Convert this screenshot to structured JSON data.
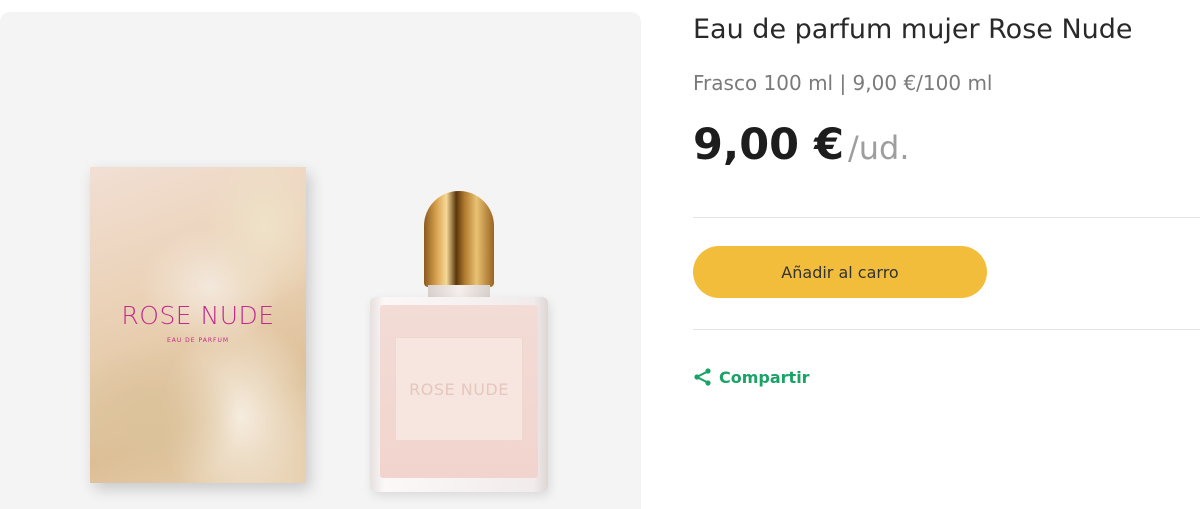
{
  "product": {
    "title": "Eau de parfum mujer Rose Nude",
    "format": "Frasco 100 ml | 9,00 €/100 ml",
    "price": "9,00 €",
    "price_unit": "/ud.",
    "add_to_cart_label": "Añadir al carro",
    "share_label": "Compartir"
  },
  "image": {
    "box_brand": "ROSE NUDE",
    "box_subtitle": "EAU DE PARFUM",
    "bottle_label": "ROSE NUDE"
  },
  "icons": {
    "share": "share-icon"
  },
  "colors": {
    "cart_button": "#f2bd3a",
    "share_accent": "#1aa267",
    "brand_pink": "#c12a8a",
    "panel_bg": "#f4f4f4"
  }
}
